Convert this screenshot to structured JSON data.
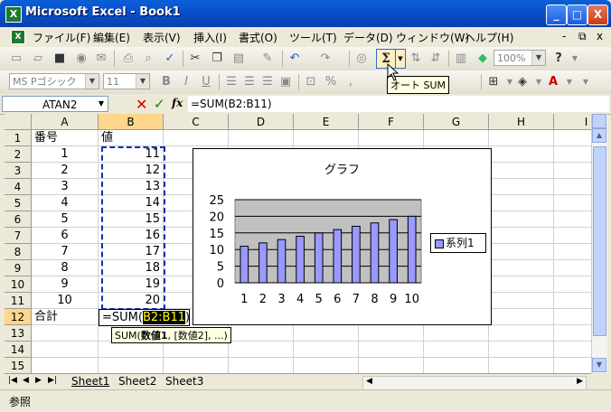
{
  "window": {
    "title": "Microsoft Excel - Book1",
    "app_icon": "X",
    "controls": [
      "_",
      "□",
      "X"
    ]
  },
  "menu": {
    "items": [
      "ファイル(F)",
      "編集(E)",
      "表示(V)",
      "挿入(I)",
      "書式(O)",
      "ツール(T)",
      "データ(D)",
      "ウィンドウ(W)",
      "ヘルプ(H)"
    ],
    "doc_controls": [
      "-",
      "⧉",
      "x"
    ]
  },
  "toolbar": {
    "zoom": "100%",
    "autosum_tooltip": "オート SUM",
    "font_name": "MS Pゴシック",
    "font_size": "11",
    "help_icon": "?"
  },
  "formula_bar": {
    "name_box": "ATAN2",
    "cancel_label": "✕",
    "enter_label": "✓",
    "fx_label": "fx",
    "content": "=SUM(B2:B11)"
  },
  "grid": {
    "columns": [
      "A",
      "B",
      "C",
      "D",
      "E",
      "F",
      "G",
      "H",
      "I"
    ],
    "rows": [
      "1",
      "2",
      "3",
      "4",
      "5",
      "6",
      "7",
      "8",
      "9",
      "10",
      "11",
      "12",
      "13",
      "14",
      "15"
    ],
    "a_values": [
      "番号",
      "1",
      "2",
      "3",
      "4",
      "5",
      "6",
      "7",
      "8",
      "9",
      "10",
      "合計"
    ],
    "b_values": [
      "値",
      "11",
      "12",
      "13",
      "14",
      "15",
      "16",
      "17",
      "18",
      "19",
      "20"
    ],
    "editing_prefix": "=SUM(",
    "editing_range": "B2:B11",
    "editing_suffix": ")",
    "argument_tip_fn": "SUM(",
    "argument_tip_bold": "数値1",
    "argument_tip_rest": ", [数値2], ...)"
  },
  "chart_data": {
    "type": "bar",
    "title": "グラフ",
    "categories": [
      "1",
      "2",
      "3",
      "4",
      "5",
      "6",
      "7",
      "8",
      "9",
      "10"
    ],
    "series": [
      {
        "name": "系列1",
        "values": [
          11,
          12,
          13,
          14,
          15,
          16,
          17,
          18,
          19,
          20
        ],
        "color": "#9999ff"
      }
    ],
    "ylim": [
      0,
      25
    ],
    "yticks": [
      "0",
      "5",
      "10",
      "15",
      "20",
      "25"
    ],
    "grid": true,
    "plot_background": "#c0c0c0",
    "legend_position": "right"
  },
  "sheets": {
    "tabs": [
      "Sheet1",
      "Sheet2",
      "Sheet3"
    ],
    "active": "Sheet1"
  },
  "status": {
    "mode": "参照"
  },
  "colors": {
    "titlebar": "#0a4ec7",
    "selection_header": "#ffd78c",
    "marquee": "#1b2ea8",
    "bar": "#9999ff"
  }
}
